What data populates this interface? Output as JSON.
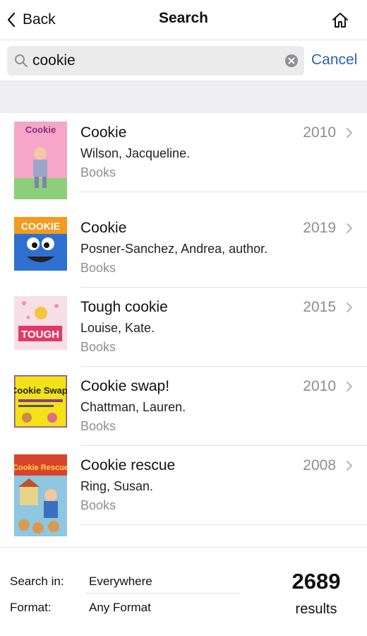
{
  "nav": {
    "back_label": "Back",
    "title": "Search"
  },
  "search": {
    "value": "cookie",
    "cancel_label": "Cancel"
  },
  "results": [
    {
      "title": "Cookie",
      "author": "Wilson, Jacqueline.",
      "format": "Books",
      "year": "2010",
      "cover_text": "Cookie",
      "cover_colors": [
        "#e06aa6",
        "#8ccf7a"
      ]
    },
    {
      "title": "Cookie",
      "author": "Posner-Sanchez, Andrea, author.",
      "format": "Books",
      "year": "2019",
      "cover_text": "COOKIE",
      "cover_colors": [
        "#f39a1f",
        "#2f6fd0"
      ]
    },
    {
      "title": "Tough cookie",
      "author": "Louise, Kate.",
      "format": "Books",
      "year": "2015",
      "cover_text": "TOUGH",
      "cover_colors": [
        "#f7dfe8",
        "#e23a66"
      ]
    },
    {
      "title": "Cookie swap!",
      "author": "Chattman, Lauren.",
      "format": "Books",
      "year": "2010",
      "cover_text": "Cookie Swap!",
      "cover_colors": [
        "#f3e21a",
        "#8a3f88"
      ]
    },
    {
      "title": "Cookie rescue",
      "author": "Ring, Susan.",
      "format": "Books",
      "year": "2008",
      "cover_text": "Cookie Rescue",
      "cover_colors": [
        "#d9432b",
        "#8fc6e0"
      ]
    }
  ],
  "footer": {
    "search_in_label": "Search in:",
    "search_in_value": "Everywhere",
    "format_label": "Format:",
    "format_value": "Any Format",
    "count": "2689",
    "count_label": "results"
  },
  "colors": {
    "accent": "#2a64b4",
    "muted": "#8e8e93",
    "band": "#eeeef0"
  }
}
